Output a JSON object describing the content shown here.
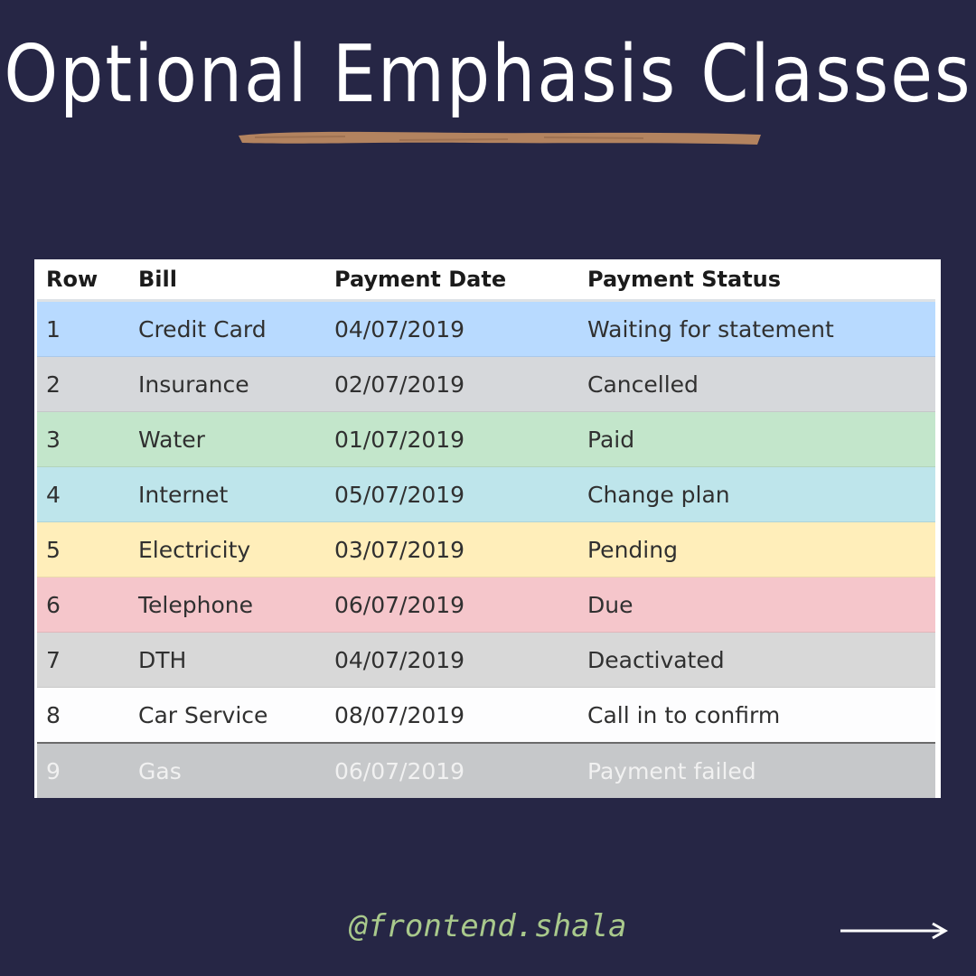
{
  "title": "Optional Emphasis Classes",
  "table": {
    "headers": [
      "Row",
      "Bill",
      "Payment Date",
      "Payment Status"
    ],
    "rows": [
      {
        "row": "1",
        "bill": "Credit Card",
        "date": "04/07/2019",
        "status": "Waiting for statement",
        "bg": "#b8daff"
      },
      {
        "row": "2",
        "bill": "Insurance",
        "date": "02/07/2019",
        "status": "Cancelled",
        "bg": "#d6d8db"
      },
      {
        "row": "3",
        "bill": "Water",
        "date": "01/07/2019",
        "status": "Paid",
        "bg": "#c3e6cb"
      },
      {
        "row": "4",
        "bill": "Internet",
        "date": "05/07/2019",
        "status": "Change plan",
        "bg": "#bee5eb"
      },
      {
        "row": "5",
        "bill": "Electricity",
        "date": "03/07/2019",
        "status": "Pending",
        "bg": "#ffeeba"
      },
      {
        "row": "6",
        "bill": "Telephone",
        "date": "06/07/2019",
        "status": "Due",
        "bg": "#f5c6cb"
      },
      {
        "row": "7",
        "bill": "DTH",
        "date": "04/07/2019",
        "status": "Deactivated",
        "bg": "#d8d8d8"
      },
      {
        "row": "8",
        "bill": "Car Service",
        "date": "08/07/2019",
        "status": "Call in to confirm",
        "bg": "#fdfdfe"
      },
      {
        "row": "9",
        "bill": "Gas",
        "date": "06/07/2019",
        "status": "Payment failed",
        "bg": "#c6c8ca",
        "dark": true
      }
    ]
  },
  "footer": {
    "handle": "@frontend.shala",
    "arrow_icon": "arrow-right-icon"
  },
  "colors": {
    "background": "#262645",
    "brush": "#b3835f",
    "handle": "#a9c98c"
  }
}
